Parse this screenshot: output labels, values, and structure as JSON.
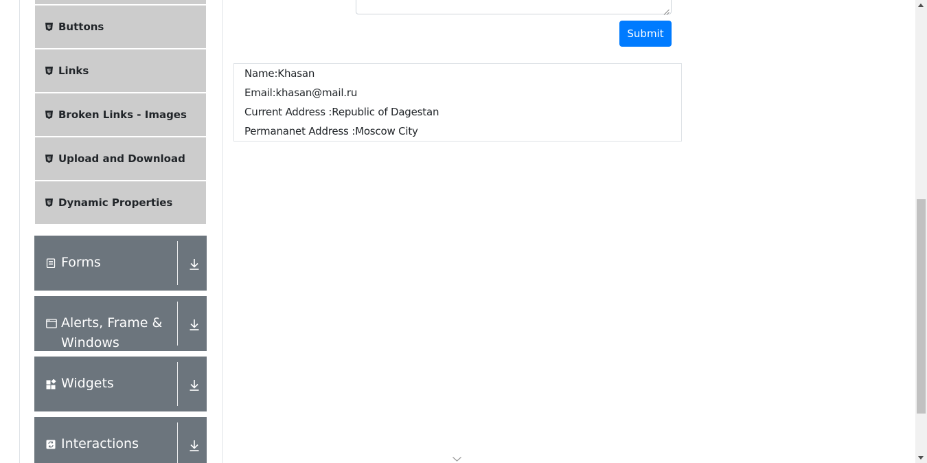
{
  "sidebar": {
    "element_items": [
      {
        "label": "Buttons",
        "icon": "html5-icon"
      },
      {
        "label": "Links",
        "icon": "html5-icon"
      },
      {
        "label": "Broken Links - Images",
        "icon": "html5-icon"
      },
      {
        "label": "Upload and Download",
        "icon": "html5-icon"
      },
      {
        "label": "Dynamic Properties",
        "icon": "html5-icon"
      }
    ],
    "groups": [
      {
        "title": "Forms",
        "icon": "form-icon"
      },
      {
        "title": "Alerts, Frame & Windows",
        "icon": "window-icon"
      },
      {
        "title": "Widgets",
        "icon": "widgets-icon"
      },
      {
        "title": "Interactions",
        "icon": "interactions-icon"
      }
    ]
  },
  "form": {
    "submit_label": "Submit"
  },
  "output": {
    "name": "Name:Khasan",
    "email": "Email:khasan@mail.ru",
    "current_address": "Current Address :Republic of Dagestan",
    "permanent_address": "Permananet Address :Moscow City"
  },
  "colors": {
    "sidebar_item_bg": "#cccccc",
    "group_bg": "#6c757d",
    "primary": "#007bff"
  }
}
